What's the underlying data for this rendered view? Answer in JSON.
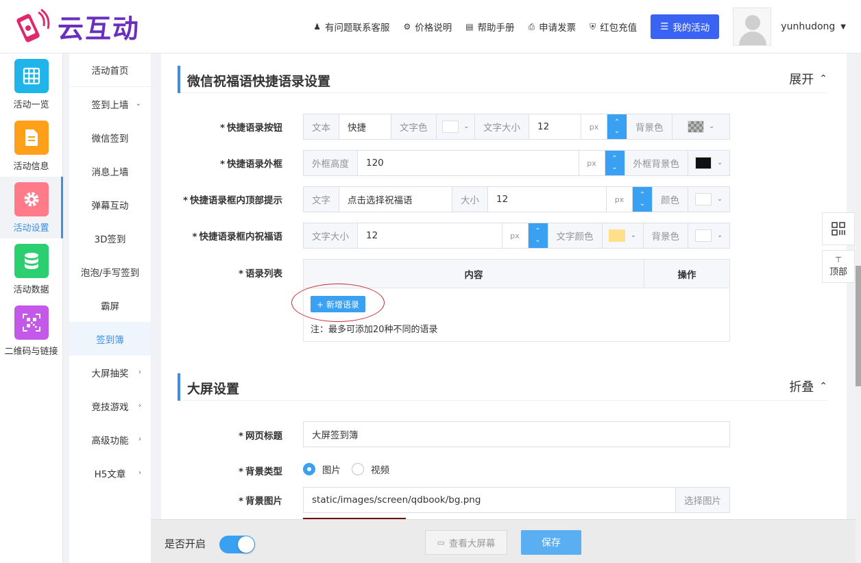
{
  "header": {
    "logo_text": "云互动",
    "nav": [
      {
        "label": "有问题联系客服",
        "icon": "user-plus-icon"
      },
      {
        "label": "价格说明",
        "icon": "gear-icon"
      },
      {
        "label": "帮助手册",
        "icon": "book-icon"
      },
      {
        "label": "申请发票",
        "icon": "printer-icon"
      },
      {
        "label": "红包充值",
        "icon": "shield-check-icon"
      }
    ],
    "my_activity": "我的活动",
    "username": "yunhudong"
  },
  "rail": [
    {
      "label": "活动一览",
      "color": "#1fb5ea"
    },
    {
      "label": "活动信息",
      "color": "#ff9f1a"
    },
    {
      "label": "活动设置",
      "color": "#ff7b8a"
    },
    {
      "label": "活动数据",
      "color": "#2ccf6f"
    },
    {
      "label": "二维码与链接",
      "color": "#c458e8"
    }
  ],
  "submenu": [
    {
      "label": "活动首页"
    },
    {
      "label": "签到上墙"
    },
    {
      "label": "微信签到"
    },
    {
      "label": "消息上墙"
    },
    {
      "label": "弹幕互动"
    },
    {
      "label": "3D签到"
    },
    {
      "label": "泡泡/手写签到"
    },
    {
      "label": "霸屏"
    },
    {
      "label": "签到簿"
    },
    {
      "label": "大屏抽奖"
    },
    {
      "label": "竞技游戏"
    },
    {
      "label": "高级功能"
    },
    {
      "label": "H5文章"
    }
  ],
  "section1": {
    "title": "微信祝福语快捷语录设置",
    "toggle": "展开",
    "rows": {
      "button": {
        "label": "快捷语录按钮",
        "text_addon": "文本",
        "text_value": "快捷",
        "color_addon": "文字色",
        "size_addon": "文字大小",
        "size_value": "12",
        "unit": "px",
        "bg_addon": "背景色"
      },
      "frame": {
        "label": "快捷语录外框",
        "height_addon": "外框高度",
        "height_value": "120",
        "unit": "px",
        "bg_addon": "外框背景色"
      },
      "tip": {
        "label": "快捷语录框内顶部提示",
        "text_addon": "文字",
        "text_value": "点击选择祝福语",
        "size_addon": "大小",
        "size_value": "12",
        "unit": "px",
        "color_addon": "颜色"
      },
      "blessing": {
        "label": "快捷语录框内祝福语",
        "size_addon": "文字大小",
        "size_value": "12",
        "unit": "px",
        "color_addon": "文字颜色",
        "bg_addon": "背景色"
      }
    },
    "list": {
      "label": "语录列表",
      "col_content": "内容",
      "col_action": "操作",
      "add_button": "+ 新增语录",
      "note": "注：最多可添加20种不同的语录"
    }
  },
  "section2": {
    "title": "大屏设置",
    "toggle": "折叠",
    "page_title_label": "网页标题",
    "page_title_value": "大屏签到簿",
    "bg_type_label": "背景类型",
    "bg_type_options": [
      "图片",
      "视频"
    ],
    "bg_image_label": "背景图片",
    "bg_image_value": "static/images/screen/qdbook/bg.png",
    "choose_image": "选择图片"
  },
  "footer": {
    "enable_label": "是否开启",
    "view_screen": "查看大屏幕",
    "save": "保存"
  },
  "float": {
    "top_label": "顶部"
  },
  "colors": {
    "accent": "#3a8ee6",
    "primary_button": "#3a63f3",
    "stepper": "#3aa0f2",
    "frame_bg_swatch": "#111111",
    "blessing_color_swatch": "#ffe08a",
    "annotation_ring": "#c8272d"
  }
}
